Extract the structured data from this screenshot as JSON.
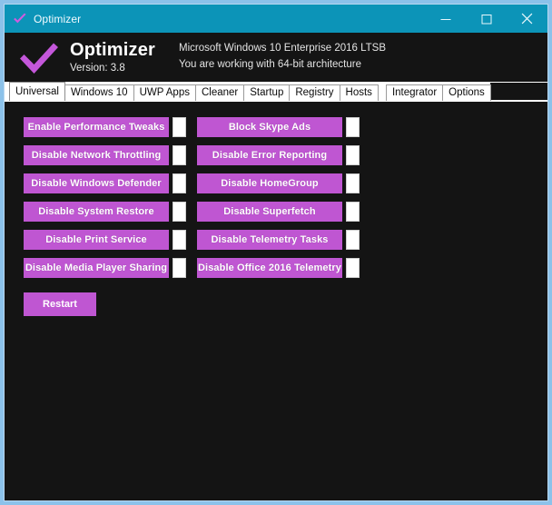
{
  "window": {
    "titlebar": {
      "icon": "check-icon",
      "title": "Optimizer",
      "minimize_label": "minimize-icon",
      "maximize_label": "maximize-icon",
      "close_label": "close-icon"
    },
    "colors": {
      "titlebar_bg": "#0c94b8",
      "window_border": "#8cc2ea",
      "panel_bg": "#141414",
      "accent_purple": "#bf56d2",
      "checkbox_bg": "#ffffff"
    }
  },
  "header": {
    "logo": "check-icon",
    "app_name": "Optimizer",
    "version": "Version: 3.8",
    "os_line1": "Microsoft Windows 10 Enterprise 2016 LTSB",
    "os_line2": "You are working with 64-bit architecture"
  },
  "tabs": {
    "active_index": 0,
    "items": [
      {
        "label": "Universal",
        "active": true,
        "gap_before": false
      },
      {
        "label": "Windows 10",
        "active": false,
        "gap_before": false
      },
      {
        "label": "UWP Apps",
        "active": false,
        "gap_before": false
      },
      {
        "label": "Cleaner",
        "active": false,
        "gap_before": false
      },
      {
        "label": "Startup",
        "active": false,
        "gap_before": false
      },
      {
        "label": "Registry",
        "active": false,
        "gap_before": false
      },
      {
        "label": "Hosts",
        "active": false,
        "gap_before": false
      },
      {
        "label": "Integrator",
        "active": false,
        "gap_before": true
      },
      {
        "label": "Options",
        "active": false,
        "gap_before": false
      }
    ]
  },
  "universal_tab": {
    "rows": [
      {
        "left": {
          "label": "Enable Performance Tweaks",
          "checked": false
        },
        "right": {
          "label": "Block Skype Ads",
          "checked": false
        }
      },
      {
        "left": {
          "label": "Disable Network Throttling",
          "checked": false
        },
        "right": {
          "label": "Disable Error Reporting",
          "checked": false
        }
      },
      {
        "left": {
          "label": "Disable Windows Defender",
          "checked": false
        },
        "right": {
          "label": "Disable HomeGroup",
          "checked": false
        }
      },
      {
        "left": {
          "label": "Disable System Restore",
          "checked": false
        },
        "right": {
          "label": "Disable Superfetch",
          "checked": false
        }
      },
      {
        "left": {
          "label": "Disable Print Service",
          "checked": false
        },
        "right": {
          "label": "Disable Telemetry Tasks",
          "checked": false
        }
      },
      {
        "left": {
          "label": "Disable Media Player Sharing",
          "checked": false
        },
        "right": {
          "label": "Disable Office 2016 Telemetry",
          "checked": false
        }
      }
    ],
    "restart_label": "Restart"
  }
}
